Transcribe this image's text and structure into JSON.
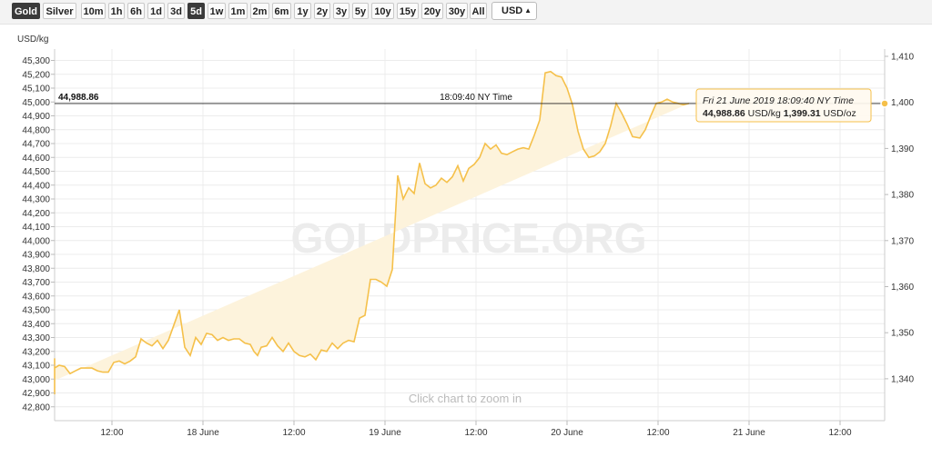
{
  "toolbar": {
    "metals": [
      "Gold",
      "Silver"
    ],
    "active_metal": "Gold",
    "ranges": [
      "10m",
      "1h",
      "6h",
      "1d",
      "3d",
      "5d",
      "1w",
      "1m",
      "2m",
      "6m",
      "1y",
      "2y",
      "3y",
      "5y",
      "10y",
      "15y",
      "20y",
      "30y",
      "All"
    ],
    "active_range": "5d",
    "currency": "USD"
  },
  "colors": {
    "line": "#f5c04a",
    "fill": "#fdf3dc",
    "active_button": "#3a3a3a"
  },
  "chart_data": {
    "type": "area",
    "y_unit_left": "USD/kg",
    "y_ticks_left": [
      "45,300",
      "45,200",
      "45,100",
      "45,000",
      "44,900",
      "44,800",
      "44,700",
      "44,600",
      "44,500",
      "44,400",
      "44,300",
      "44,200",
      "44,100",
      "44,000",
      "43,900",
      "43,800",
      "43,700",
      "43,600",
      "43,500",
      "43,400",
      "43,300",
      "43,200",
      "43,100",
      "43,000",
      "42,900",
      "42,800"
    ],
    "y_ticks_right": [
      "1,410",
      "1,400",
      "1,390",
      "1,380",
      "1,370",
      "1,360",
      "1,350",
      "1,340"
    ],
    "x_ticks": [
      "12:00",
      "18 June",
      "12:00",
      "19 June",
      "12:00",
      "20 June",
      "12:00",
      "21 June",
      "12:00"
    ],
    "ylim": [
      42780,
      45360
    ],
    "grid": true,
    "watermark": "GOLDPRICE.ORG",
    "hint": "Click chart to zoom in",
    "crosshair": {
      "value_label": "44,988.86",
      "time_label": "18:09:40 NY Time",
      "value": 44988.86
    },
    "tooltip": {
      "line1": "Fri 21 June 2019 18:09:40 NY Time",
      "kg_value": "44,988.86",
      "kg_unit": "USD/kg",
      "oz_value": "1,399.31",
      "oz_unit": "USD/oz"
    },
    "series": [
      {
        "points_x_days": [
          -0.6,
          -0.58,
          -0.56,
          -0.53,
          -0.5,
          -0.47,
          -0.44,
          -0.41,
          -0.38,
          -0.35,
          -0.32,
          -0.29,
          -0.26,
          -0.23,
          -0.2,
          -0.17,
          -0.14,
          -0.11,
          -0.08,
          -0.05,
          -0.02,
          0.01,
          0.04,
          0.07,
          0.1,
          0.13,
          0.16,
          0.19,
          0.22,
          0.25,
          0.28,
          0.31,
          0.34,
          0.37,
          0.4,
          0.43,
          0.46,
          0.49,
          0.52,
          0.55,
          0.58,
          0.61,
          0.64,
          0.67,
          0.7,
          0.73,
          0.76,
          0.78,
          0.8,
          0.82,
          0.85,
          0.88,
          0.91,
          0.94,
          0.97,
          1.0,
          1.03,
          1.06,
          1.09,
          1.12,
          1.15,
          1.18,
          1.21,
          1.24,
          1.27,
          1.3,
          1.33,
          1.36,
          1.39,
          1.42,
          1.45,
          1.48,
          1.51,
          1.54,
          1.57,
          1.6,
          1.63,
          1.66,
          1.69,
          1.72,
          1.75,
          1.78,
          1.81,
          1.84,
          1.87,
          1.9,
          1.93,
          1.96,
          1.99,
          2.02,
          2.05,
          2.08,
          2.11,
          2.14,
          2.17,
          2.2,
          2.23,
          2.26,
          2.29,
          2.32,
          2.35,
          2.38,
          2.41,
          2.44,
          2.47,
          2.5,
          2.53,
          2.56,
          2.59,
          2.62,
          2.65,
          2.68,
          2.71,
          2.74,
          2.77,
          2.8,
          2.83,
          2.86,
          2.9,
          2.93,
          2.96,
          2.99,
          3.02,
          3.05,
          3.08,
          3.11,
          3.14,
          3.17,
          3.2,
          3.23,
          3.26,
          3.29,
          3.32,
          3.35,
          3.38,
          3.41,
          3.44,
          3.47,
          3.5,
          3.53,
          3.56,
          3.59,
          3.62,
          3.65,
          3.68,
          3.71,
          3.74,
          3.77,
          3.8,
          3.83,
          3.86,
          3.89,
          3.92,
          3.95,
          3.98,
          4.01,
          4.04,
          4.07,
          4.1,
          4.13,
          4.16,
          4.19,
          4.22,
          4.25,
          4.28,
          4.31,
          4.34,
          4.37,
          4.4,
          4.43
        ],
        "values": [
          42990,
          42910,
          42890,
          42900,
          42930,
          42930,
          43000,
          43130,
          43150,
          43020,
          43080,
          43100,
          43090,
          43040,
          43060,
          43080,
          43080,
          43080,
          43060,
          43050,
          43050,
          43120,
          43130,
          43110,
          43130,
          43160,
          43290,
          43260,
          43240,
          43280,
          43220,
          43280,
          43390,
          43500,
          43230,
          43170,
          43300,
          43250,
          43330,
          43320,
          43280,
          43300,
          43280,
          43290,
          43290,
          43260,
          43250,
          43200,
          43170,
          43230,
          43240,
          43300,
          43240,
          43200,
          43260,
          43200,
          43170,
          43160,
          43180,
          43140,
          43210,
          43200,
          43260,
          43220,
          43260,
          43280,
          43270,
          43440,
          43460,
          43720,
          43720,
          43700,
          43670,
          43790,
          44470,
          44300,
          44380,
          44340,
          44560,
          44410,
          44380,
          44400,
          44450,
          44420,
          44460,
          44540,
          44430,
          44520,
          44550,
          44600,
          44700,
          44660,
          44690,
          44630,
          44620,
          44640,
          44660,
          44670,
          44660,
          44760,
          44870,
          45210,
          45220,
          45190,
          45180,
          45100,
          44980,
          44790,
          44660,
          44600,
          44610,
          44640,
          44700,
          44830,
          44990,
          44920,
          44840,
          44750,
          44740,
          44800,
          44900,
          44990,
          45000,
          45020,
          45000,
          44990,
          44980,
          44988.86
        ]
      }
    ]
  }
}
